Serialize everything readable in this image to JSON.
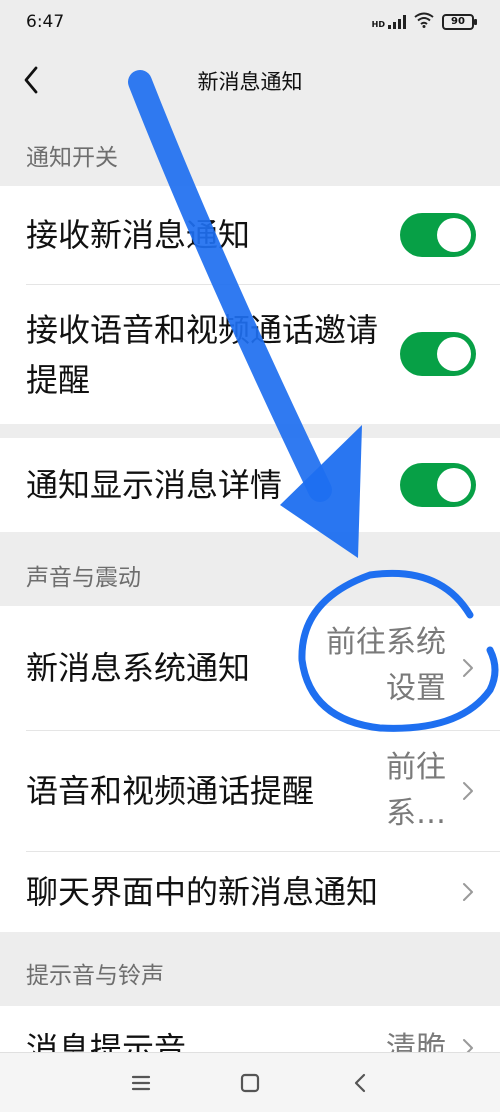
{
  "status_bar": {
    "time": "6:47",
    "network": "HD",
    "battery": "90"
  },
  "nav": {
    "title": "新消息通知"
  },
  "sections": {
    "notify_switch": {
      "header": "通知开关"
    },
    "sound_vibration": {
      "header": "声音与震动"
    },
    "tone_ringtone": {
      "header": "提示音与铃声"
    }
  },
  "rows": {
    "receive_new_msg": {
      "label": "接收新消息通知",
      "on": true
    },
    "receive_voice_video": {
      "label": "接收语音和视频通话邀请提醒",
      "on": true
    },
    "show_details": {
      "label": "通知显示消息详情",
      "on": true
    },
    "system_notification": {
      "label": "新消息系统通知",
      "value": "前往系统设置"
    },
    "voice_video_reminder": {
      "label": "语音和视频通话提醒",
      "value": "前往系…"
    },
    "chat_notification": {
      "label": "聊天界面中的新消息通知"
    },
    "msg_tone": {
      "label": "消息提示音",
      "value": "清脆"
    }
  },
  "colors": {
    "toggle_on": "#07a046",
    "annotation": "#1e6ff0"
  },
  "icons": {
    "back": "chevron-left-icon",
    "row_arrow": "chevron-right-icon",
    "menu": "menu-icon",
    "home": "home-square-icon",
    "back_nav": "back-triangle-icon"
  }
}
